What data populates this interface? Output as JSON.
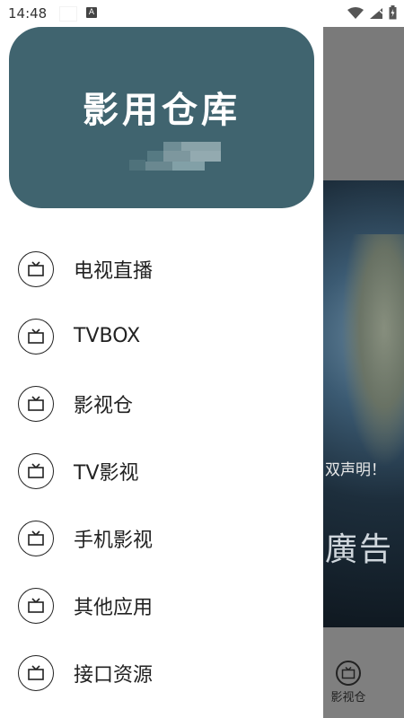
{
  "status_bar": {
    "time": "14:48",
    "notification_icon": "a-icon",
    "icons": [
      "wifi-icon",
      "signal-icon",
      "battery-icon"
    ]
  },
  "drawer": {
    "header_title": "影用仓库",
    "header_color": "#40646f",
    "menu_items": [
      {
        "label": "电视直播",
        "icon": "tv-icon"
      },
      {
        "label": "TVBOX",
        "icon": "tv-icon"
      },
      {
        "label": "影视仓",
        "icon": "tv-icon"
      },
      {
        "label": "TV影视",
        "icon": "tv-icon"
      },
      {
        "label": "手机影视",
        "icon": "tv-icon"
      },
      {
        "label": "其他应用",
        "icon": "tv-icon"
      },
      {
        "label": "接口资源",
        "icon": "tv-icon"
      }
    ]
  },
  "background_app": {
    "banner_text_small": "双声明！",
    "banner_text_large": "廣告",
    "tab_label": "影视仓",
    "tab_icon": "tv-icon"
  }
}
